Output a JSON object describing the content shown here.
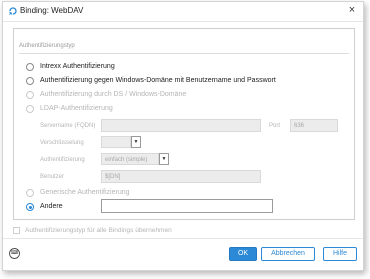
{
  "window": {
    "title": "Binding: WebDAV",
    "close_label": "×"
  },
  "group": {
    "title": "Authentifizierungstyp"
  },
  "options": {
    "intrexx": "Intrexx Authentifizierung",
    "windows_domain": "Authentifizierung gegen Windows-Domäne mit Benutzername und Passwort",
    "ds_domain": "Authentifizierung durch DS / Windows-Domäne",
    "ldap": "LDAP-Authentifizierung",
    "generic": "Generische Authentifizierung",
    "other": "Andere"
  },
  "ldap": {
    "server_label": "Servername (FQDN)",
    "server_value": "",
    "port_label": "Port",
    "port_value": "636",
    "encryption_label": "Verschlüsselung",
    "encryption_value": "",
    "auth_label": "Authentifizierung",
    "auth_value": "einfach (simple)",
    "user_label": "Benutzer",
    "user_value": "$[DN]"
  },
  "other": {
    "value": ""
  },
  "selected_option": "other",
  "apply_all": {
    "label": "Authentifizierungstyp für alle Bindings übernehmen",
    "checked": false
  },
  "buttons": {
    "ok": "OK",
    "cancel": "Abbrechen",
    "help": "Hilfe"
  },
  "colors": {
    "accent": "#2b89d6",
    "disabled_text": "#b5b5b5"
  },
  "icons": {
    "app": "binding-icon",
    "help": "keyboard-help-icon",
    "close": "close-icon"
  }
}
